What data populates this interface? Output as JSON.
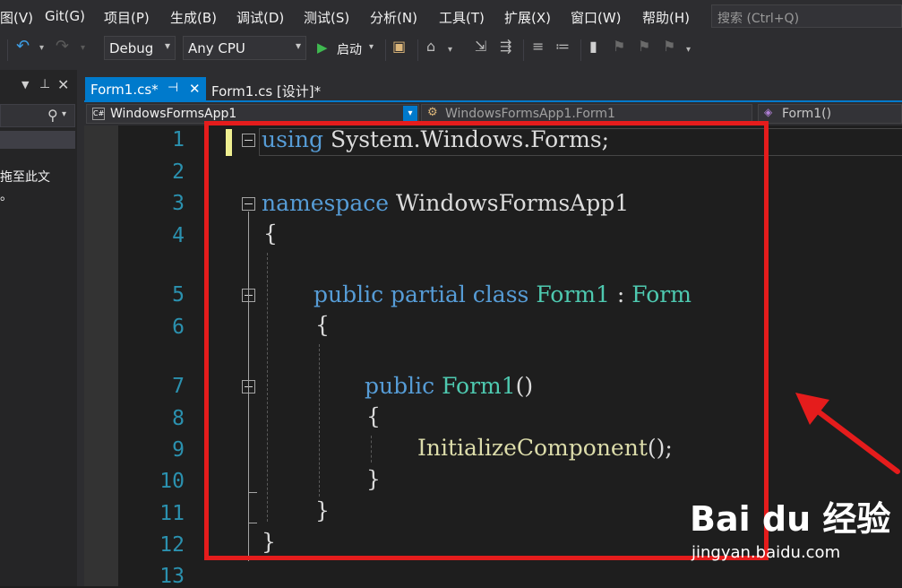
{
  "menu": {
    "items": [
      "图(V)",
      "Git(G)",
      "项目(P)",
      "生成(B)",
      "调试(D)",
      "测试(S)",
      "分析(N)",
      "工具(T)",
      "扩展(X)",
      "窗口(W)",
      "帮助(H)"
    ],
    "search_placeholder": "搜索 (Ctrl+Q)"
  },
  "toolbar": {
    "config": "Debug",
    "platform": "Any CPU",
    "start_label": "启动"
  },
  "left_panel": {
    "text_line1": "项拖至此文",
    "text_line2": "箱。"
  },
  "tabs": [
    {
      "label": "Form1.cs*",
      "active": true
    },
    {
      "label": "Form1.cs [设计]*",
      "active": false
    }
  ],
  "navbar": {
    "project": "WindowsFormsApp1",
    "class": "WindowsFormsApp1.Form1",
    "member": "Form1()"
  },
  "editor": {
    "line_numbers": [
      "1",
      "2",
      "3",
      "4",
      "5",
      "6",
      "7",
      "8",
      "9",
      "10",
      "11",
      "12",
      "13"
    ],
    "code": {
      "l1_kw": "using",
      "l1_rest": " System.Windows.Forms;",
      "l3_kw": "namespace",
      "l3_rest": " WindowsFormsApp1",
      "l4": "{",
      "l5_kw": "public partial class",
      "l5_type": "Form1",
      "l5_sep": " : ",
      "l5_base": "Form",
      "l6": "{",
      "l7_kw": "public",
      "l7_name": "Form1",
      "l7_rest": "()",
      "l8": "{",
      "l9_fn": "InitializeComponent",
      "l9_rest": "();",
      "l10": "}",
      "l11": "}",
      "l12": "}"
    }
  },
  "watermark": {
    "logo": "Bai du 经验",
    "url": "jingyan.baidu.com"
  },
  "colors": {
    "keyword": "#569cd6",
    "type": "#4ec9b0",
    "method": "#dcdcaa",
    "line_number": "#2b91af",
    "accent": "#007acc",
    "annotation": "#e51c1c"
  }
}
